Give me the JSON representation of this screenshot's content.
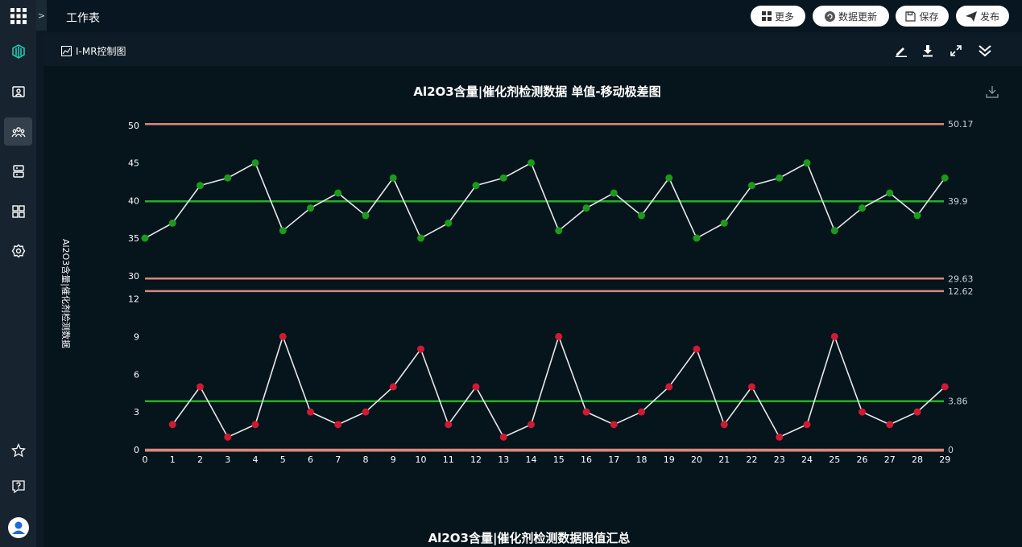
{
  "app": {
    "sheet_title": "工作表",
    "toggle_glyph": ">"
  },
  "toolbar": {
    "more_label": "更多",
    "refresh_label": "数据更新",
    "save_label": "保存",
    "publish_label": "发布"
  },
  "rail": {
    "icons": [
      "apps-grid-icon",
      "brand-logo-icon",
      "folder-user-icon",
      "users-icon",
      "server-icon",
      "dashboard-icon",
      "settings-icon",
      "star-icon",
      "help-icon",
      "user-avatar-icon"
    ]
  },
  "panel": {
    "name": "I-MR控制图",
    "icons": [
      "edit-icon",
      "download-icon",
      "fullscreen-icon",
      "collapse-icon"
    ]
  },
  "colors": {
    "points_individual": "#1c9a1c",
    "points_range": "#d01a33",
    "center_line": "#22b322",
    "control_limit": "#d9877a",
    "series_line": "#e8e8e8"
  },
  "chart_data": [
    {
      "type": "line",
      "title": "Al2O3含量|催化剂检测数据 单值-移动极差图",
      "ylabel": "Al2O3含量|催化剂检测数据",
      "x": [
        0,
        1,
        2,
        3,
        4,
        5,
        6,
        7,
        8,
        9,
        10,
        11,
        12,
        13,
        14,
        15,
        16,
        17,
        18,
        19,
        20,
        21,
        22,
        23,
        24,
        25,
        26,
        27,
        28,
        29
      ],
      "ylim": [
        30,
        50
      ],
      "yticks": [
        50,
        45,
        40,
        35,
        30
      ],
      "series": [
        {
          "values": [
            35,
            37,
            42,
            43,
            45,
            36,
            39,
            41,
            38,
            43,
            35,
            37,
            42,
            43,
            45,
            36,
            39,
            41,
            38,
            43,
            35,
            37,
            42,
            43,
            45,
            36,
            39,
            41,
            38,
            43
          ]
        }
      ],
      "control_lines": {
        "ucl": 50.17,
        "cl": 39.9,
        "lcl": 29.63
      },
      "control_labels": {
        "ucl": "50.17",
        "cl": "39.9",
        "lcl": "29.63"
      }
    },
    {
      "type": "line",
      "x": [
        0,
        1,
        2,
        3,
        4,
        5,
        6,
        7,
        8,
        9,
        10,
        11,
        12,
        13,
        14,
        15,
        16,
        17,
        18,
        19,
        20,
        21,
        22,
        23,
        24,
        25,
        26,
        27,
        28,
        29
      ],
      "xticks": [
        "0",
        "1",
        "2",
        "3",
        "4",
        "5",
        "6",
        "7",
        "8",
        "9",
        "10",
        "11",
        "12",
        "13",
        "14",
        "15",
        "16",
        "17",
        "18",
        "19",
        "20",
        "21",
        "22",
        "23",
        "24",
        "25",
        "26",
        "27",
        "28",
        "29"
      ],
      "ylim": [
        0,
        12
      ],
      "yticks": [
        12,
        9,
        6,
        3,
        0
      ],
      "series": [
        {
          "start_x": 1,
          "values": [
            2,
            5,
            1,
            2,
            9,
            3,
            2,
            3,
            5,
            8,
            2,
            5,
            1,
            2,
            9,
            3,
            2,
            3,
            5,
            8,
            2,
            5,
            1,
            2,
            9,
            3,
            2,
            3,
            5
          ]
        }
      ],
      "control_lines": {
        "ucl": 12.62,
        "cl": 3.86,
        "lcl": 0
      },
      "control_labels": {
        "ucl": "12.62",
        "cl": "3.86",
        "lcl": "0"
      }
    }
  ],
  "summary_title": "Al2O3含量|催化剂检测数据限值汇总"
}
